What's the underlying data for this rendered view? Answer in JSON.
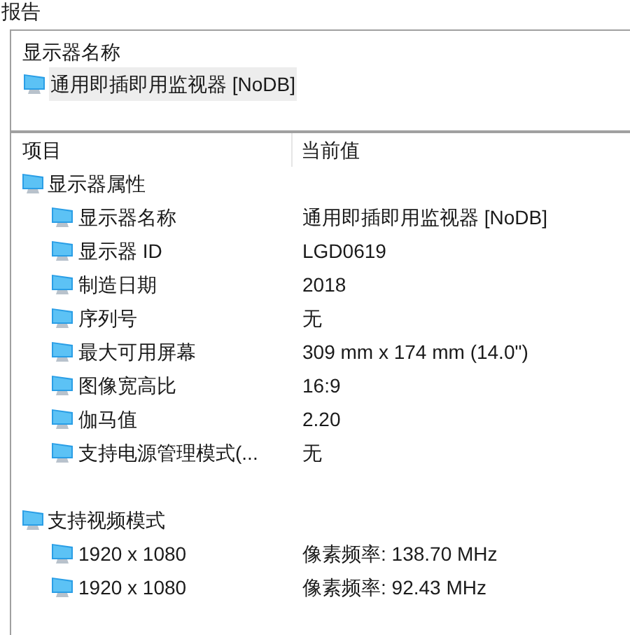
{
  "title": "报告",
  "summary": {
    "label": "显示器名称",
    "device": {
      "name": "通用即插即用监视器 [NoDB]",
      "selected": true
    }
  },
  "columns": [
    "项目",
    "当前值"
  ],
  "groups": [
    {
      "label": "显示器属性",
      "items": [
        {
          "item": "显示器名称",
          "value": "通用即插即用监视器 [NoDB]"
        },
        {
          "item": "显示器 ID",
          "value": "LGD0619"
        },
        {
          "item": "制造日期",
          "value": "2018"
        },
        {
          "item": "序列号",
          "value": "无"
        },
        {
          "item": "最大可用屏幕",
          "value": "309 mm x 174 mm (14.0\")"
        },
        {
          "item": "图像宽高比",
          "value": "16:9"
        },
        {
          "item": "伽马值",
          "value": "2.20"
        },
        {
          "item": "支持电源管理模式(...",
          "value": "无"
        }
      ]
    },
    {
      "label": "支持视频模式",
      "items": [
        {
          "item": "1920 x 1080",
          "value": "像素频率: 138.70 MHz"
        },
        {
          "item": "1920 x 1080",
          "value": "像素频率: 92.43 MHz"
        }
      ]
    }
  ]
}
